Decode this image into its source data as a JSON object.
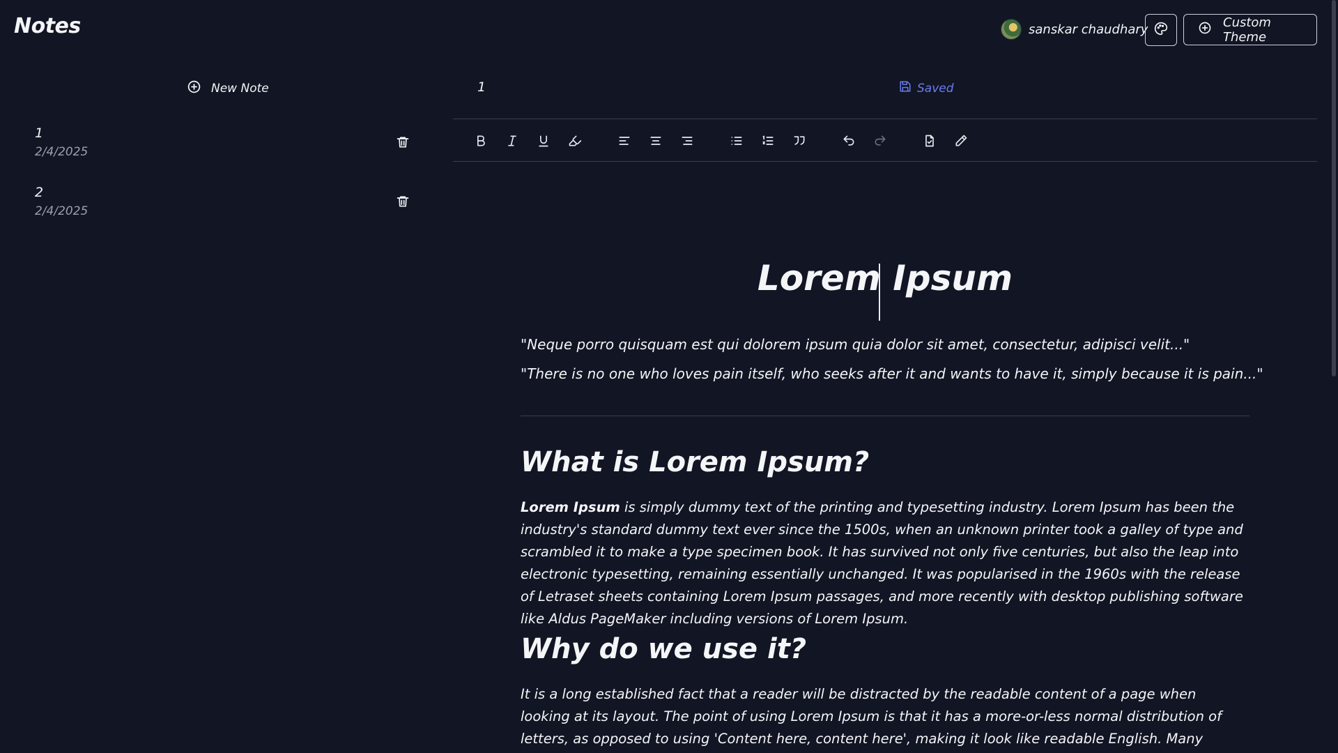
{
  "header": {
    "brand": "Notes",
    "user_name": "sanskar chaudhary",
    "custom_theme_label": "Custom Theme"
  },
  "sidebar": {
    "new_note_label": "New Note",
    "notes": [
      {
        "title": "1",
        "date": "2/4/2025"
      },
      {
        "title": "2",
        "date": "2/4/2025"
      }
    ]
  },
  "editor": {
    "doc_title": "1",
    "status": "Saved",
    "toolbar_icons": [
      "bold-icon",
      "italic-icon",
      "underline-icon",
      "highlighter-icon",
      "align-left-icon",
      "align-center-icon",
      "align-right-icon",
      "bullet-list-icon",
      "ordered-list-icon",
      "quote-icon",
      "undo-icon",
      "redo-icon",
      "export-icon",
      "pen-icon"
    ]
  },
  "content": {
    "title": "Lorem Ipsum",
    "quote1": "\"Neque porro quisquam est qui dolorem ipsum quia dolor sit amet, consectetur, adipisci velit...\"",
    "quote2": "\"There is no one who loves pain itself, who seeks after it and wants to have it, simply because it is pain...\"",
    "h2_what": "What is Lorem Ipsum?",
    "para1_bold": "Lorem Ipsum",
    "para1_rest": " is simply dummy text of the printing and typesetting industry. Lorem Ipsum has been the industry's standard dummy text ever since the 1500s, when an unknown printer took a galley of type and scrambled it to make a type specimen book. It has survived not only five centuries, but also the leap into electronic typesetting, remaining essentially unchanged. It was popularised in the 1960s with the release of Letraset sheets containing Lorem Ipsum passages, and more recently with desktop publishing software like Aldus PageMaker including versions of Lorem Ipsum.",
    "h2_why": "Why do we use it?",
    "para2": "It is a long established fact that a reader will be distracted by the readable content of a page when looking at its layout. The point of using Lorem Ipsum is that it has a more-or-less normal distribution of letters, as opposed to using 'Content here, content here', making it look like readable English. Many desktop publishing packages and web page"
  },
  "colors": {
    "background": "#111524",
    "saved_accent": "#6b7cf0"
  }
}
